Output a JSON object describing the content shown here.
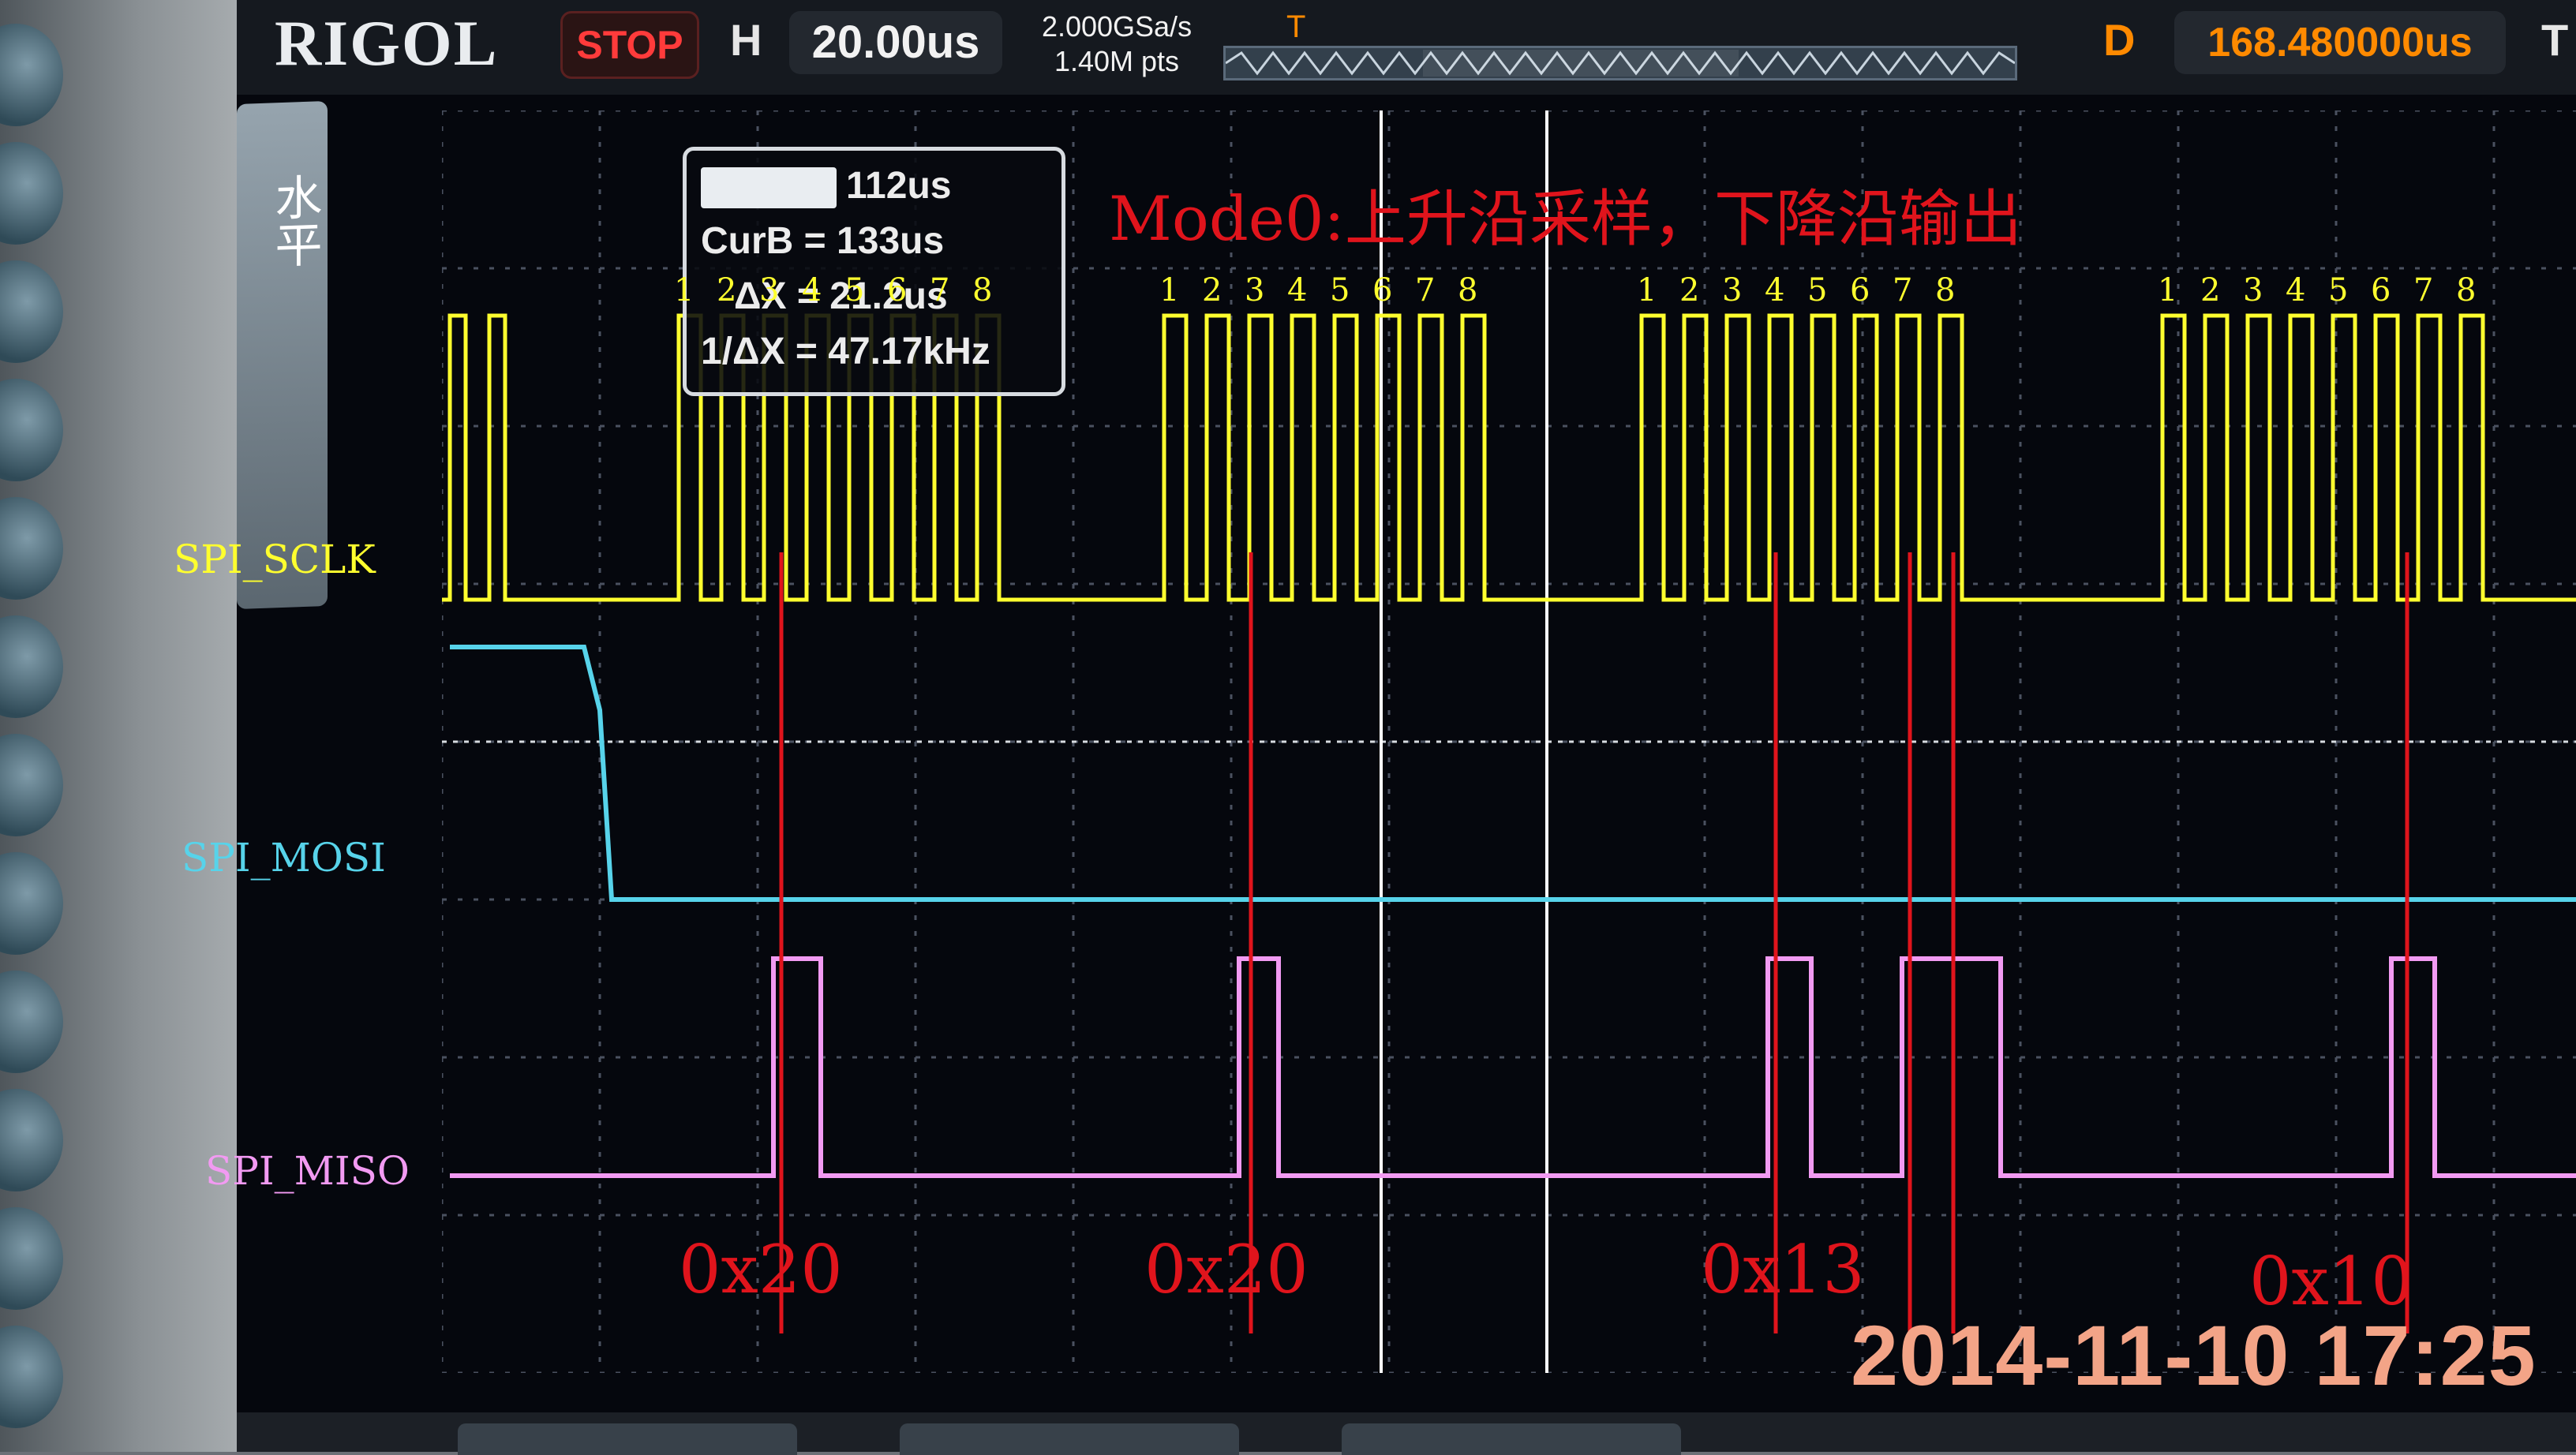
{
  "status": {
    "brand": "RIGOL",
    "run_state": "STOP",
    "h_label": "H",
    "timebase": "20.00us",
    "sample_rate": "2.000GSa/s",
    "memory_depth": "1.40M pts",
    "d_label": "D",
    "delay": "168.480000us",
    "t_label": "T",
    "trigger_marker": "T"
  },
  "menu": {
    "label": "水平"
  },
  "cursor": {
    "cura_value": "112us",
    "curb_label": "CurB =",
    "curb_value": "133us",
    "dx_label": "ΔX =",
    "dx_value": "21.2us",
    "inv_dx_label": "1/ΔX =",
    "inv_dx_value": "47.17kHz"
  },
  "annotation": {
    "title": "Mode0:上升沿采样，下降沿输出",
    "bit_numbers": [
      "1",
      "2",
      "3",
      "4",
      "5",
      "6",
      "7",
      "8"
    ],
    "bytes": [
      "0x20",
      "0x20",
      "0x13",
      "0x10"
    ]
  },
  "channels": [
    {
      "name": "SPI_SCLK",
      "color": "#ffff2e"
    },
    {
      "name": "SPI_MOSI",
      "color": "#57d3ea"
    },
    {
      "name": "SPI_MISO",
      "color": "#f29af2"
    }
  ],
  "colors": {
    "accent": "#ff8a00",
    "note": "#e0141c",
    "stop": "#ff3b3b"
  },
  "timestamp": "2014-11-10 17:25"
}
